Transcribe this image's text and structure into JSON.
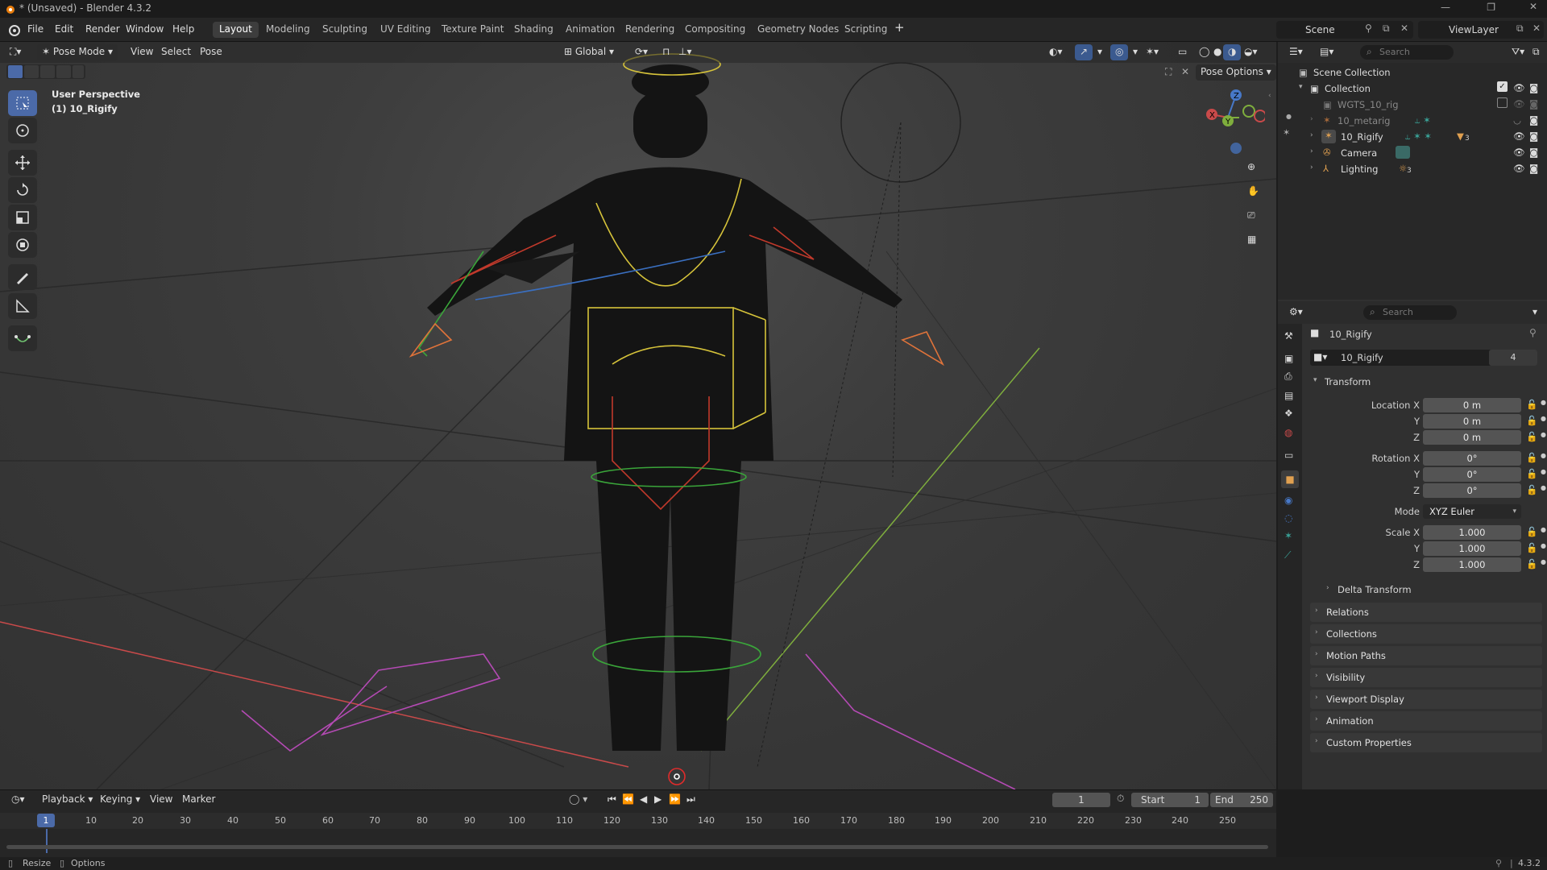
{
  "app": {
    "title": "* (Unsaved) - Blender 4.3.2",
    "version": "4.3.2"
  },
  "menu": [
    "File",
    "Edit",
    "Render",
    "Window",
    "Help"
  ],
  "workspaces": [
    "Layout",
    "Modeling",
    "Sculpting",
    "UV Editing",
    "Texture Paint",
    "Shading",
    "Animation",
    "Rendering",
    "Compositing",
    "Geometry Nodes",
    "Scripting"
  ],
  "active_workspace": "Layout",
  "scene": {
    "name": "Scene",
    "view_layer": "ViewLayer"
  },
  "viewport": {
    "mode": "Pose Mode",
    "menus": [
      "View",
      "Select",
      "Pose"
    ],
    "transform_orientation": "Global",
    "pose_options": "Pose Options",
    "overlay_title": "User Perspective",
    "overlay_object": "(1) 10_Rigify",
    "gizmo_axes": [
      "X",
      "Y",
      "Z"
    ]
  },
  "outliner": {
    "search_placeholder": "Search",
    "root": "Scene Collection",
    "collection": "Collection",
    "items": [
      {
        "name": "WGTS_10_rig",
        "dim": true
      },
      {
        "name": "10_metarig",
        "dim": true
      },
      {
        "name": "10_Rigify",
        "badge": "3"
      },
      {
        "name": "Camera"
      },
      {
        "name": "Lighting",
        "badge": "3"
      }
    ]
  },
  "properties": {
    "search_placeholder": "Search",
    "object_name": "10_Rigify",
    "datablock_name": "10_Rigify",
    "users": "4",
    "transform_label": "Transform",
    "location": {
      "label": "Location X",
      "x": "0 m",
      "y": "0 m",
      "z": "0 m"
    },
    "rotation": {
      "label": "Rotation X",
      "x": "0°",
      "y": "0°",
      "z": "0°"
    },
    "mode_label": "Mode",
    "mode_value": "XYZ Euler",
    "scale": {
      "label": "Scale X",
      "x": "1.000",
      "y": "1.000",
      "z": "1.000"
    },
    "axis_y": "Y",
    "axis_z": "Z",
    "delta_transform": "Delta Transform",
    "sections": [
      "Relations",
      "Collections",
      "Motion Paths",
      "Visibility",
      "Viewport Display",
      "Animation",
      "Custom Properties"
    ]
  },
  "timeline": {
    "menus": [
      "Playback",
      "Keying",
      "View",
      "Marker"
    ],
    "current_frame": "1",
    "start_label": "Start",
    "start": "1",
    "end_label": "End",
    "end": "250",
    "ticks": [
      "1",
      "10",
      "20",
      "30",
      "40",
      "50",
      "60",
      "70",
      "80",
      "90",
      "100",
      "110",
      "120",
      "130",
      "140",
      "150",
      "160",
      "170",
      "180",
      "190",
      "200",
      "210",
      "220",
      "230",
      "240",
      "250"
    ]
  },
  "status": {
    "left1": "Resize",
    "left2": "Options",
    "version": "4.3.2"
  },
  "colors": {
    "accent": "#4b6aa8",
    "bg": "#303030",
    "x_axis": "#c94a4a",
    "y_axis": "#7fae3d",
    "z_axis": "#4778c7"
  }
}
